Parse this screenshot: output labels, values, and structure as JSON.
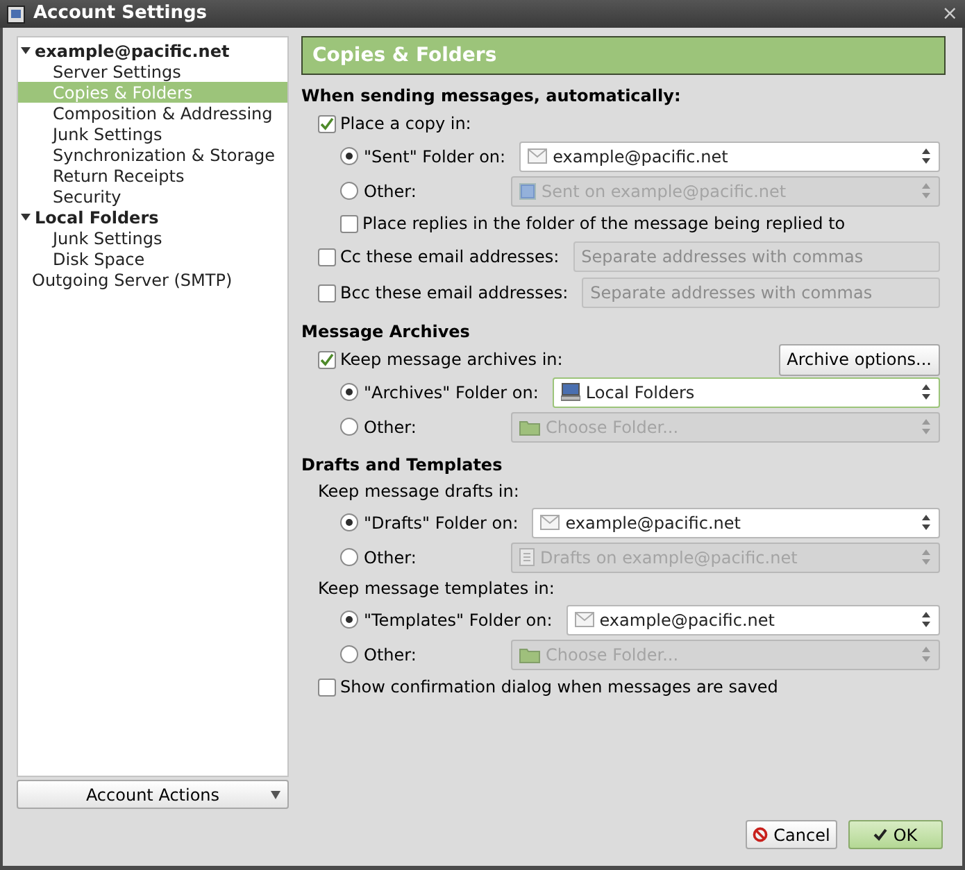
{
  "window": {
    "title": "Account Settings",
    "close": "×"
  },
  "sidebar": {
    "items": [
      {
        "label": "example@pacific.net",
        "expanded": true,
        "selected": false,
        "children": [
          {
            "label": "Server Settings",
            "selected": false
          },
          {
            "label": "Copies & Folders",
            "selected": true
          },
          {
            "label": "Composition & Addressing",
            "selected": false
          },
          {
            "label": "Junk Settings",
            "selected": false
          },
          {
            "label": "Synchronization & Storage",
            "selected": false
          },
          {
            "label": "Return Receipts",
            "selected": false
          },
          {
            "label": "Security",
            "selected": false
          }
        ]
      },
      {
        "label": "Local Folders",
        "expanded": true,
        "selected": false,
        "children": [
          {
            "label": "Junk Settings",
            "selected": false
          },
          {
            "label": "Disk Space",
            "selected": false
          }
        ]
      },
      {
        "label": "Outgoing Server (SMTP)",
        "selected": false
      }
    ],
    "actions_button": "Account Actions"
  },
  "panel": {
    "title": "Copies & Folders",
    "sections": [
      {
        "heading": "When sending messages, automatically:",
        "rows": [
          {
            "kind": "checkbox",
            "label": "Place a copy in:",
            "checked": true,
            "children": [
              {
                "kind": "radio",
                "label": "\"Sent\" Folder on:",
                "selected": true,
                "select": {
                  "kind": "account",
                  "value": "example@pacific.net",
                  "disabled": false
                }
              },
              {
                "kind": "radio",
                "label": "Other:",
                "selected": false,
                "select": {
                  "kind": "sent-folder",
                  "value": "Sent on example@pacific.net",
                  "disabled": true
                }
              },
              {
                "kind": "checkbox",
                "label": "Place replies in the folder of the message being replied to",
                "checked": false
              }
            ]
          },
          {
            "kind": "field",
            "label": "Cc these email addresses:",
            "checked": false,
            "placeholder": "Separate addresses with commas"
          },
          {
            "kind": "field",
            "label": "Bcc these email addresses:",
            "checked": false,
            "placeholder": "Separate addresses with commas"
          }
        ]
      },
      {
        "heading": "Message Archives",
        "rows": [
          {
            "kind": "checkbox",
            "label": "Keep message archives in:",
            "checked": true,
            "button": "Archive options...",
            "children": [
              {
                "kind": "radio",
                "label": "\"Archives\" Folder on:",
                "selected": true,
                "select": {
                  "kind": "local-folders",
                  "value": "Local Folders",
                  "disabled": false,
                  "focused": true
                }
              },
              {
                "kind": "radio",
                "label": "Other:",
                "selected": false,
                "select": {
                  "kind": "folder",
                  "value": "Choose Folder...",
                  "disabled": true
                }
              }
            ]
          }
        ]
      },
      {
        "heading": "Drafts and Templates",
        "rows": [
          {
            "kind": "text",
            "label": "Keep message drafts in:",
            "children": [
              {
                "kind": "radio",
                "label": "\"Drafts\" Folder on:",
                "selected": true,
                "select": {
                  "kind": "account",
                  "value": "example@pacific.net",
                  "disabled": false
                }
              },
              {
                "kind": "radio",
                "label": "Other:",
                "selected": false,
                "select": {
                  "kind": "drafts-folder",
                  "value": "Drafts on example@pacific.net",
                  "disabled": true
                }
              }
            ]
          },
          {
            "kind": "text",
            "label": "Keep message templates in:",
            "children": [
              {
                "kind": "radio",
                "label": "\"Templates\" Folder on:",
                "selected": true,
                "select": {
                  "kind": "account",
                  "value": "example@pacific.net",
                  "disabled": false
                }
              },
              {
                "kind": "radio",
                "label": "Other:",
                "selected": false,
                "select": {
                  "kind": "folder",
                  "value": "Choose Folder...",
                  "disabled": true
                }
              }
            ]
          },
          {
            "kind": "checkbox",
            "label": "Show confirmation dialog when messages are saved",
            "checked": false
          }
        ]
      }
    ]
  },
  "buttons": [
    {
      "kind": "cancel",
      "label": "Cancel"
    },
    {
      "kind": "ok",
      "label": "OK"
    }
  ]
}
